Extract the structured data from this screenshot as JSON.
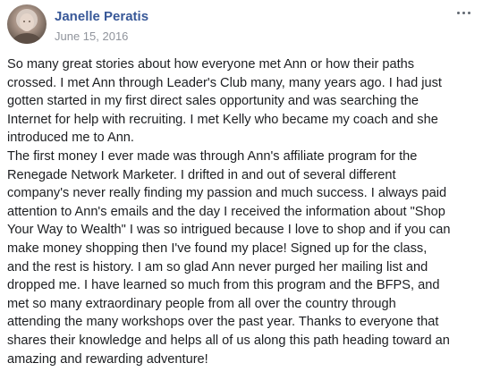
{
  "post": {
    "author": "Janelle Peratis",
    "date": "June 15, 2016",
    "more_icon": "ellipsis-horizontal-icon",
    "paragraphs": [
      "So many great stories about how everyone met Ann or how their paths\ncrossed. I met Ann through Leader's Club many, many years ago. I had just\ngotten started in my first direct sales opportunity and was searching the\nInternet for help with recruiting. I met Kelly who became my coach and she\nintroduced me to Ann.",
      "The first money I ever made was through Ann's affiliate program for the\nRenegade Network Marketer. I drifted in and out of several different\ncompany's never really finding my passion and much success. I always paid\nattention to Ann's emails and the day I received the information about \"Shop\nYour Way to Wealth\" I was so intrigued because I love to shop and if you can\nmake money shopping then I've found my place! Signed up for the class,\nand the rest is history. I am so glad Ann never purged her mailing list and\ndropped me. I have learned so much from this program and the BFPS, and\nmet so many extraordinary people from all over the country through\nattending the many workshops over the past year. Thanks to everyone that\nshares their knowledge and helps all of us along this path heading toward an\namazing and rewarding adventure!"
    ]
  },
  "colors": {
    "author_link": "#385898",
    "date_text": "#90949c",
    "body_text": "#1c1e21"
  }
}
